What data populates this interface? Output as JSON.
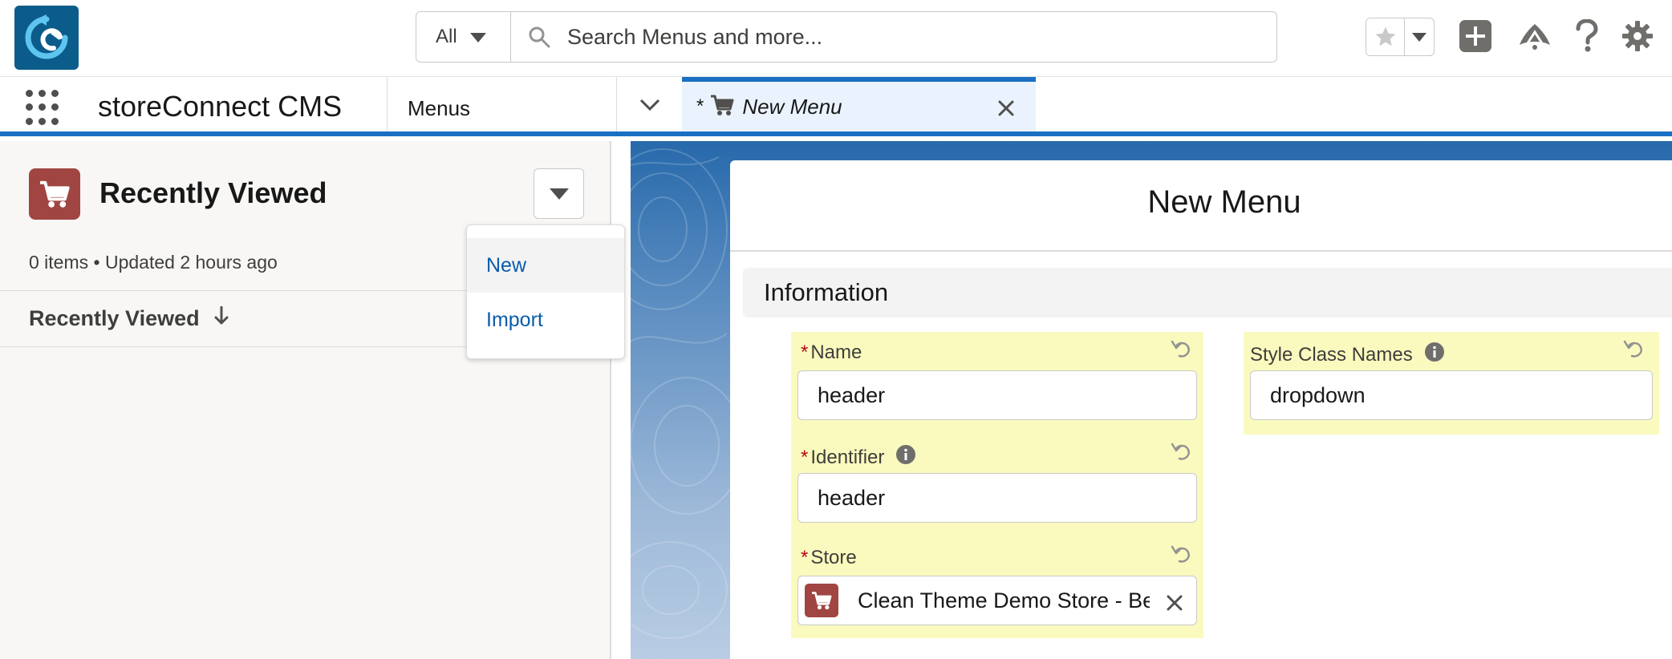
{
  "header": {
    "search_scope": "All",
    "search_placeholder": "Search Menus and more..."
  },
  "nav": {
    "app_name": "storeConnect CMS",
    "menu_item": "Menus",
    "active_tab": {
      "dirty_marker": "*",
      "label": "New Menu"
    }
  },
  "list_view": {
    "title": "Recently Viewed",
    "meta": "0 items • Updated 2 hours ago",
    "column": "Recently Viewed",
    "dropdown_items": [
      "New",
      "Import"
    ]
  },
  "modal": {
    "title": "New Menu",
    "section": "Information",
    "fields": {
      "name": {
        "label": "Name",
        "required": "*",
        "value": "header"
      },
      "identifier": {
        "label": "Identifier",
        "required": "*",
        "value": "header"
      },
      "store": {
        "label": "Store",
        "required": "*",
        "value": "Clean Theme Demo Store - Be"
      },
      "style_class_names": {
        "label": "Style Class Names",
        "value": "dropdown"
      }
    }
  },
  "colors": {
    "brand_blue": "#1b6fc2",
    "link": "#0b5cab",
    "object_icon": "#a04541",
    "dirty_field": "#fafabe",
    "required": "#ba0517"
  },
  "icons": [
    "app-logo-icon",
    "chevron-down-icon",
    "search-icon",
    "star-icon",
    "plus-icon",
    "trailhead-icon",
    "help-icon",
    "gear-icon",
    "waffle-icon",
    "cart-icon",
    "close-icon",
    "arrow-down-icon",
    "info-icon",
    "undo-icon"
  ]
}
